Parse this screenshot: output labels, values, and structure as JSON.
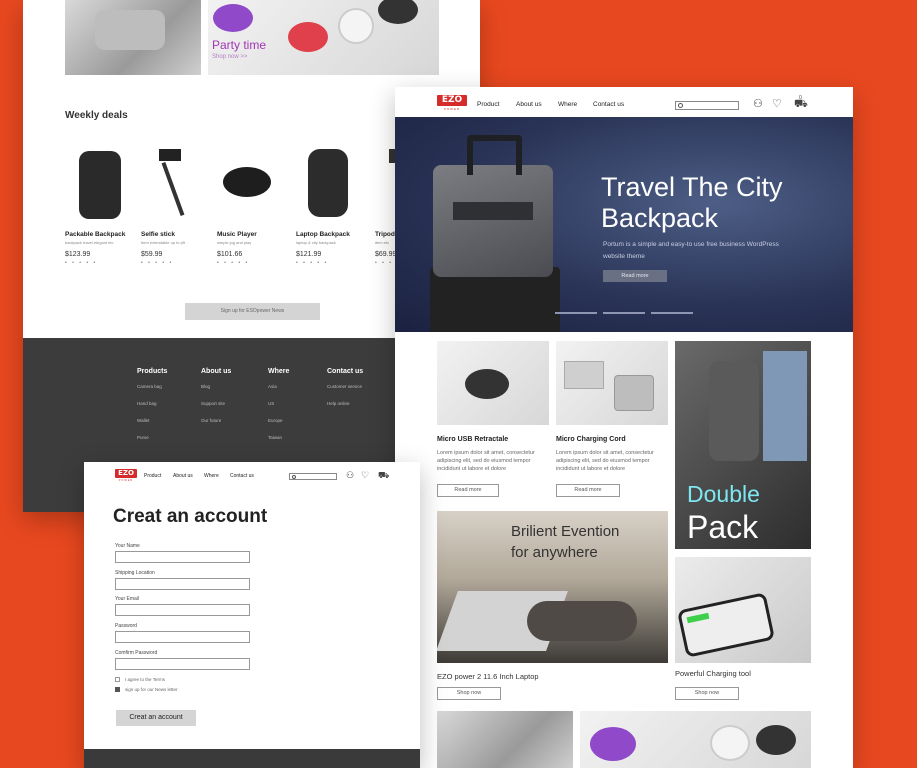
{
  "colors": {
    "background": "#e8481f",
    "brand": "#d62b2b",
    "footer": "#3c3c3c",
    "accent_party": "#a236b6"
  },
  "back_page": {
    "party_title": "Party time",
    "party_link": "Shop now >>",
    "weekly_title": "Weekly deals",
    "deals": [
      {
        "name": "Packable Backpack",
        "desc": "backpack travel elegant etc",
        "price": "$123.99",
        "stars": "• • • • •"
      },
      {
        "name": "Selfie stick",
        "desc": "Item extendable up to pft",
        "price": "$59.99",
        "stars": "• • • • •"
      },
      {
        "name": "Music Player",
        "desc": "simple jog and play",
        "price": "$101.66",
        "stars": "• • • • •"
      },
      {
        "name": "Laptop Backpack",
        "desc": "laptop & city backpack",
        "price": "$121.99",
        "stars": "• • • • •"
      },
      {
        "name": "Tripod",
        "desc": "item etc",
        "price": "$69.99",
        "stars": "• • • • •"
      }
    ],
    "signup_label": "Sign up for ESOpower News",
    "footer_cols": [
      {
        "heading": "Products",
        "items": [
          "Camera bag",
          "Hand bag",
          "Wallet",
          "Purse"
        ]
      },
      {
        "heading": "About us",
        "items": [
          "Blog",
          "Support site",
          "Our future"
        ]
      },
      {
        "heading": "Where",
        "items": [
          "Asia",
          "US",
          "Europe",
          "Taiwan"
        ]
      },
      {
        "heading": "Contact us",
        "items": [
          "Customer service",
          "Help online"
        ]
      }
    ]
  },
  "home": {
    "logo": "EZO",
    "logo_sub": "POWER",
    "nav": [
      "Product",
      "About us",
      "Where",
      "Contact us"
    ],
    "cart_count": "0",
    "hero_title": "Travel The City Backpack",
    "hero_sub": "Portum is a simple and easy-to use free business WordPress website theme",
    "hero_button": "Read more",
    "tiles": [
      {
        "title": "Micro USB Retractale",
        "desc": "Lorem ipsum dolor sit amet, consectetur adipiscing elit, sed do eiusmod tempor incididunt ut labore et dolore",
        "button": "Read more"
      },
      {
        "title": "Micro Charging Cord",
        "desc": "Lorem ipsum dolor sit amet, consectetur adipiscing elit, sed do eiusmod tempor incididunt ut labore et dolore",
        "button": "Read more"
      }
    ],
    "double_line1": "Double",
    "double_line2": "Pack",
    "brilient_line1": "Brilient Evention",
    "brilient_line2": "for anywhere",
    "laptop_caption": "EZO power 2 11.6 Inch Laptop",
    "laptop_button": "Shop now",
    "charging_caption": "Powerful Charging tool",
    "charging_button": "Shop now"
  },
  "account": {
    "logo": "EZO",
    "logo_sub": "POWER",
    "nav": [
      "Product",
      "About us",
      "Where",
      "Contact us"
    ],
    "title": "Creat an account",
    "fields": [
      "Your Name",
      "Shipping Location",
      "Your Email",
      "Password",
      "Comfirm Password"
    ],
    "terms_label": "I agree to the Terms",
    "newsletter_label": "sign up for our News letter",
    "submit": "Creat an account"
  }
}
